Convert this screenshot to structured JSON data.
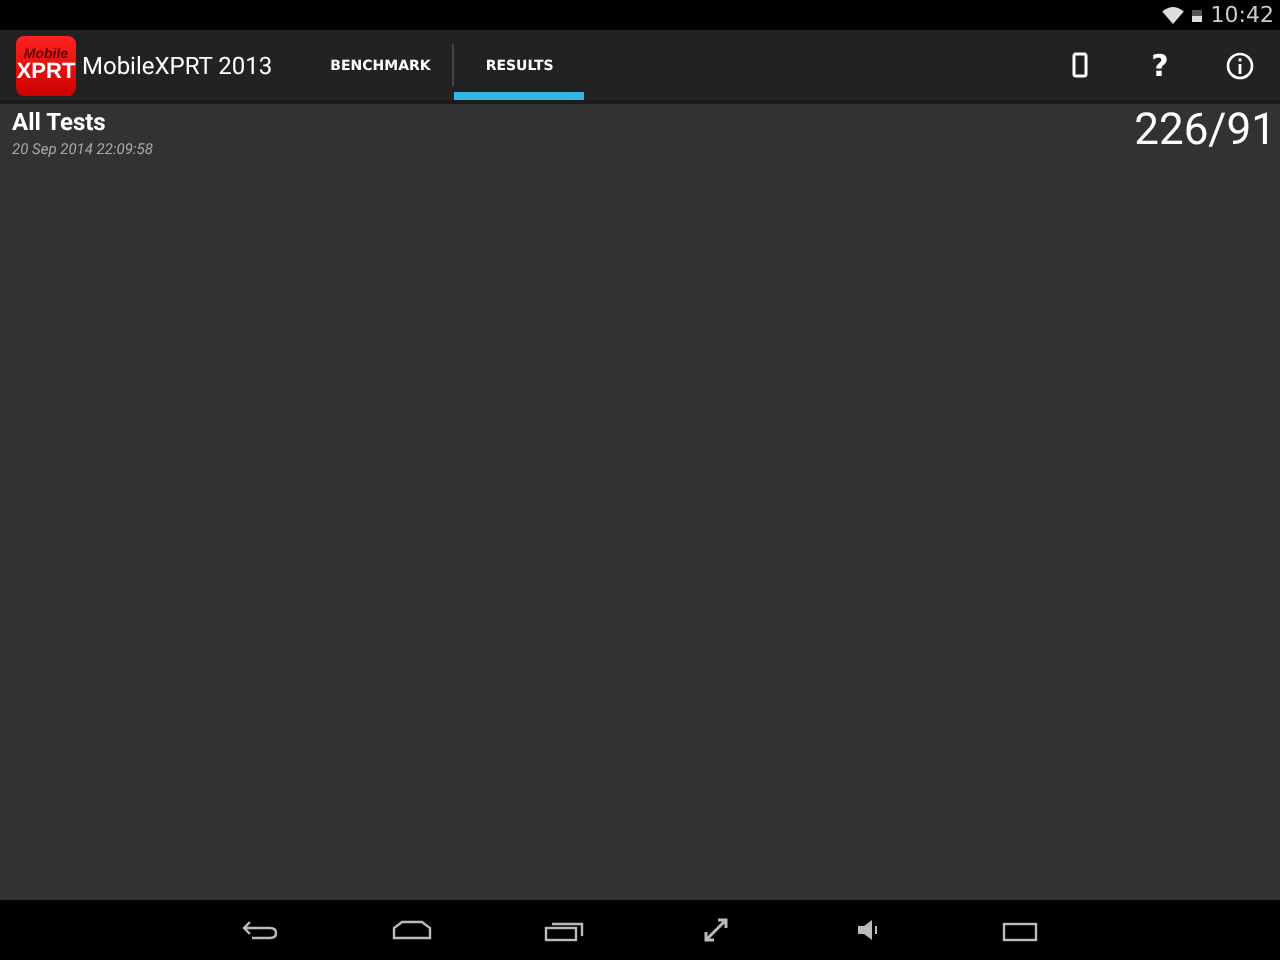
{
  "status_bar": {
    "time": "10:42"
  },
  "action_bar": {
    "logo": {
      "top": "Mobile",
      "bottom": "XPRT"
    },
    "title": "MobileXPRT 2013",
    "help_glyph": "?",
    "tabs": [
      {
        "label": "BENCHMARK",
        "selected": false
      },
      {
        "label": "RESULTS",
        "selected": true
      }
    ]
  },
  "results": {
    "title": "All Tests",
    "date": "20 Sep 2014 22:09:58",
    "score": "226/91"
  }
}
